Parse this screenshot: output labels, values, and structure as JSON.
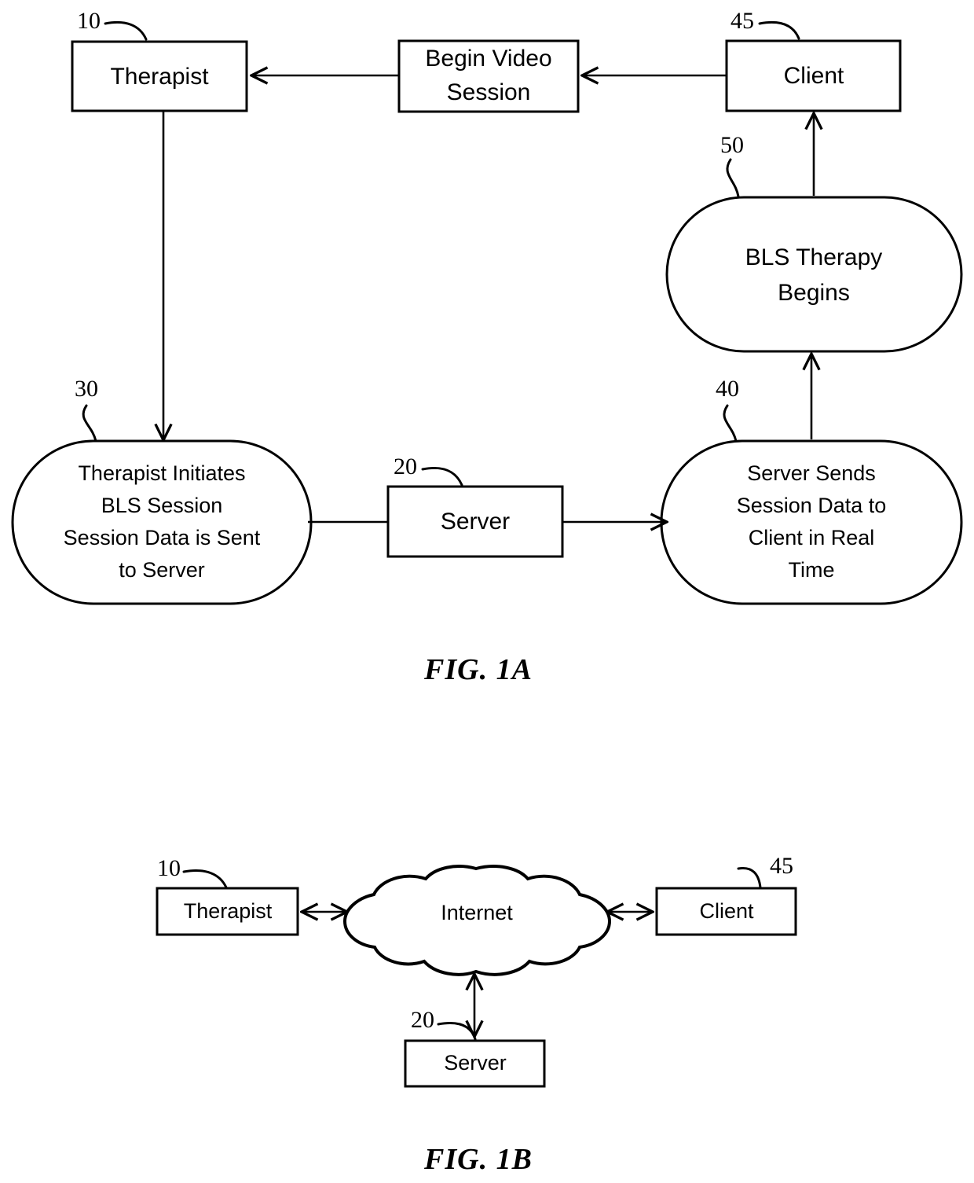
{
  "figures": [
    {
      "id": "fig-1a",
      "caption": "FIG. 1A",
      "nodes": {
        "therapist": {
          "label": "Therapist",
          "ref": "10",
          "shape": "rect"
        },
        "begin_video_session": {
          "line1": "Begin Video",
          "line2": "Session",
          "shape": "rect"
        },
        "client": {
          "label": "Client",
          "ref": "45",
          "shape": "rect"
        },
        "bls_therapy_begins": {
          "line1": "BLS Therapy",
          "line2": "Begins",
          "ref": "50",
          "shape": "stadium"
        },
        "therapist_initiates": {
          "line1": "Therapist Initiates",
          "line2": "BLS Session",
          "line3": "Session Data is Sent",
          "line4": "to Server",
          "ref": "30",
          "shape": "stadium"
        },
        "server": {
          "label": "Server",
          "ref": "20",
          "shape": "rect"
        },
        "server_sends": {
          "line1": "Server Sends",
          "line2": "Session Data to",
          "line3": "Client in Real",
          "line4": "Time",
          "ref": "40",
          "shape": "stadium"
        }
      }
    },
    {
      "id": "fig-1b",
      "caption": "FIG. 1B",
      "nodes": {
        "therapist": {
          "label": "Therapist",
          "ref": "10",
          "shape": "rect"
        },
        "internet": {
          "label": "Internet",
          "shape": "cloud"
        },
        "client": {
          "label": "Client",
          "ref": "45",
          "shape": "rect"
        },
        "server": {
          "label": "Server",
          "ref": "20",
          "shape": "rect"
        }
      }
    }
  ],
  "colors": {
    "ink": "#000000",
    "paper": "#ffffff"
  }
}
